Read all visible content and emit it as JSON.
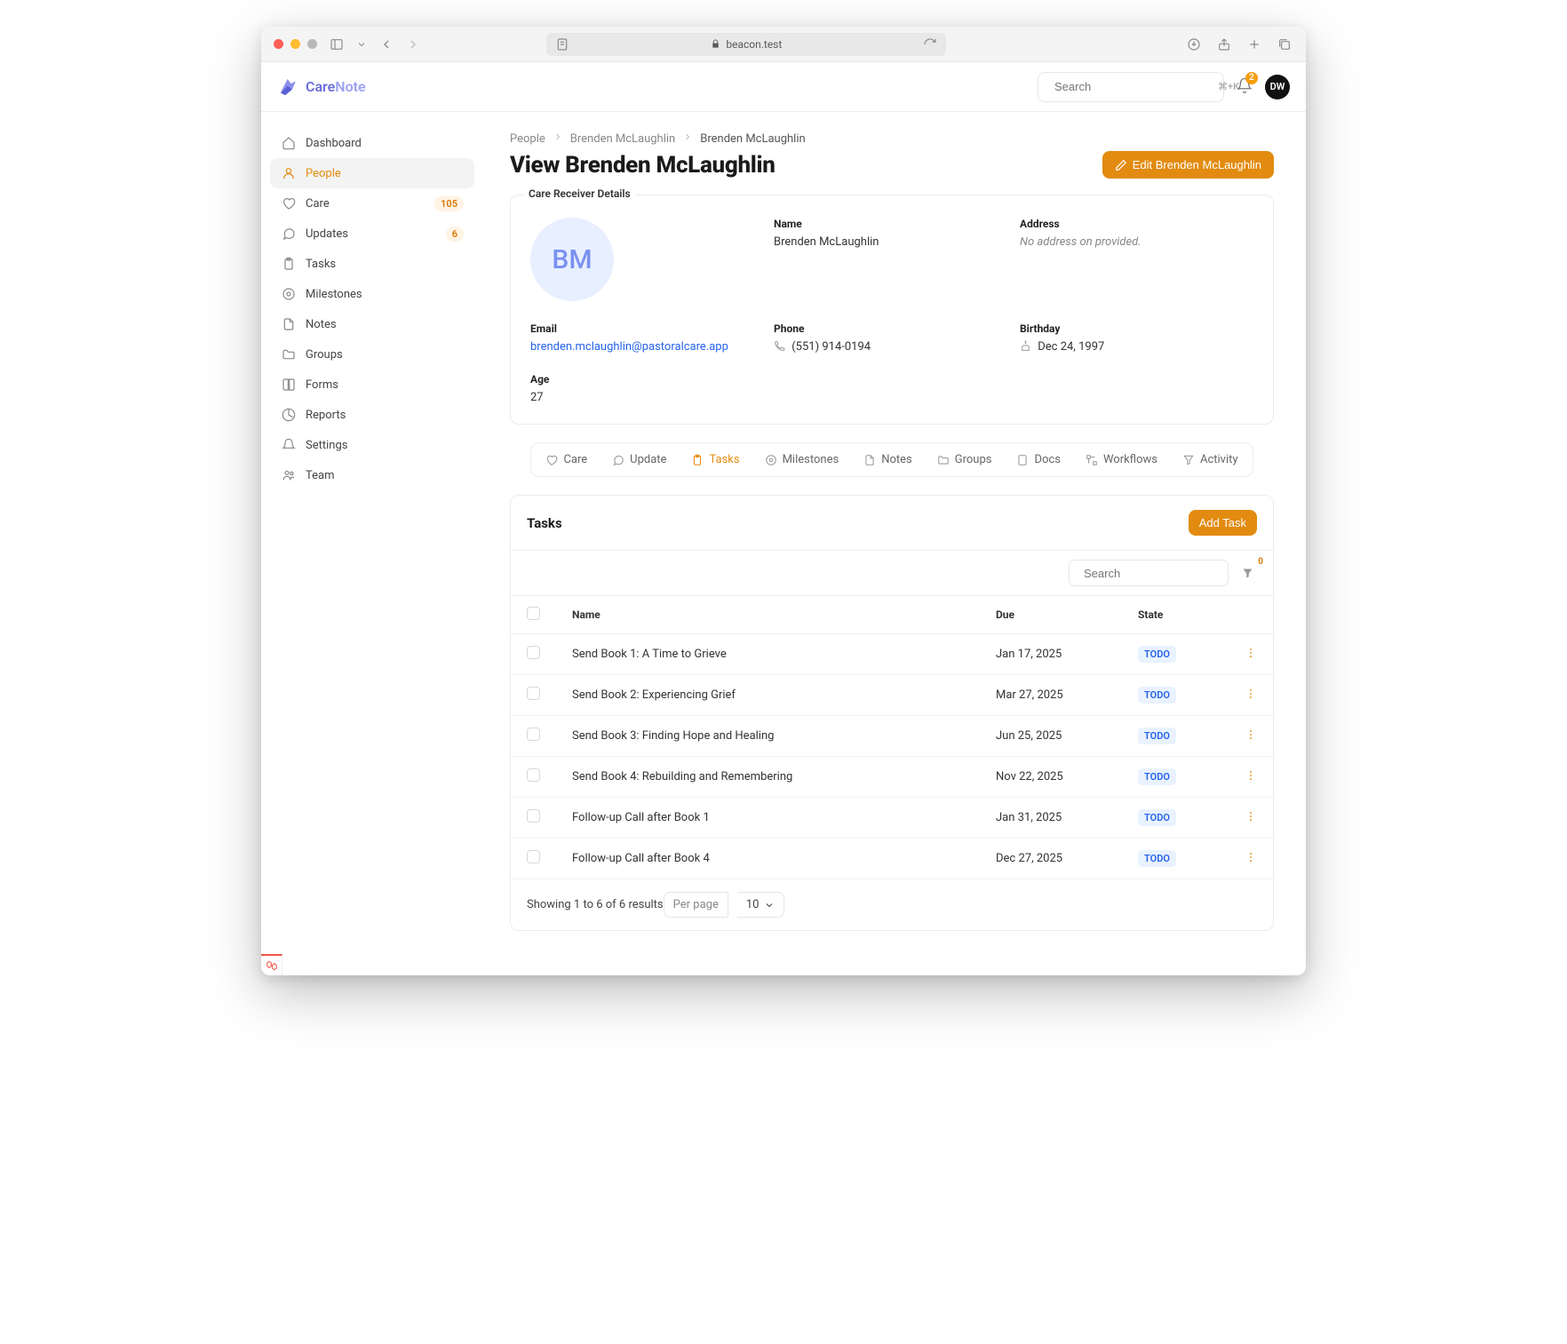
{
  "browser": {
    "url_host": "beacon.test"
  },
  "app": {
    "name_a": "Care",
    "name_b": "Note",
    "search_placeholder": "Search",
    "search_kbd": "⌘+K",
    "notif_count": "2",
    "avatar_initials": "DW"
  },
  "sidebar": {
    "items": [
      {
        "label": "Dashboard"
      },
      {
        "label": "People"
      },
      {
        "label": "Care",
        "badge": "105"
      },
      {
        "label": "Updates",
        "badge": "6"
      },
      {
        "label": "Tasks"
      },
      {
        "label": "Milestones"
      },
      {
        "label": "Notes"
      },
      {
        "label": "Groups"
      },
      {
        "label": "Forms"
      },
      {
        "label": "Reports"
      },
      {
        "label": "Settings"
      },
      {
        "label": "Team"
      }
    ]
  },
  "crumbs": {
    "a": "People",
    "b": "Brenden McLaughlin",
    "c": "Brenden McLaughlin"
  },
  "page": {
    "title": "View Brenden McLaughlin",
    "edit_label": "Edit Brenden McLaughlin"
  },
  "details": {
    "legend": "Care Receiver Details",
    "avatar_initials": "BM",
    "name_label": "Name",
    "name_value": "Brenden McLaughlin",
    "address_label": "Address",
    "address_value": "No address on provided.",
    "email_label": "Email",
    "email_value": "brenden.mclaughlin@pastoralcare.app",
    "phone_label": "Phone",
    "phone_value": "(551) 914-0194",
    "birthday_label": "Birthday",
    "birthday_value": "Dec 24, 1997",
    "age_label": "Age",
    "age_value": "27"
  },
  "tabs": [
    {
      "label": "Care"
    },
    {
      "label": "Update"
    },
    {
      "label": "Tasks"
    },
    {
      "label": "Milestones"
    },
    {
      "label": "Notes"
    },
    {
      "label": "Groups"
    },
    {
      "label": "Docs"
    },
    {
      "label": "Workflows"
    },
    {
      "label": "Activity"
    }
  ],
  "tasks": {
    "heading": "Tasks",
    "add_label": "Add Task",
    "search_placeholder": "Search",
    "filter_count": "0",
    "cols": {
      "name": "Name",
      "due": "Due",
      "state": "State"
    },
    "rows": [
      {
        "name": "Send Book 1: A Time to Grieve",
        "due": "Jan 17, 2025",
        "state": "TODO"
      },
      {
        "name": "Send Book 2: Experiencing Grief",
        "due": "Mar 27, 2025",
        "state": "TODO"
      },
      {
        "name": "Send Book 3: Finding Hope and Healing",
        "due": "Jun 25, 2025",
        "state": "TODO"
      },
      {
        "name": "Send Book 4: Rebuilding and Remembering",
        "due": "Nov 22, 2025",
        "state": "TODO"
      },
      {
        "name": "Follow-up Call after Book 1",
        "due": "Jan 31, 2025",
        "state": "TODO"
      },
      {
        "name": "Follow-up Call after Book 4",
        "due": "Dec 27, 2025",
        "state": "TODO"
      }
    ],
    "results_text": "Showing 1 to 6 of 6 results",
    "perpage_label": "Per page",
    "perpage_value": "10"
  }
}
